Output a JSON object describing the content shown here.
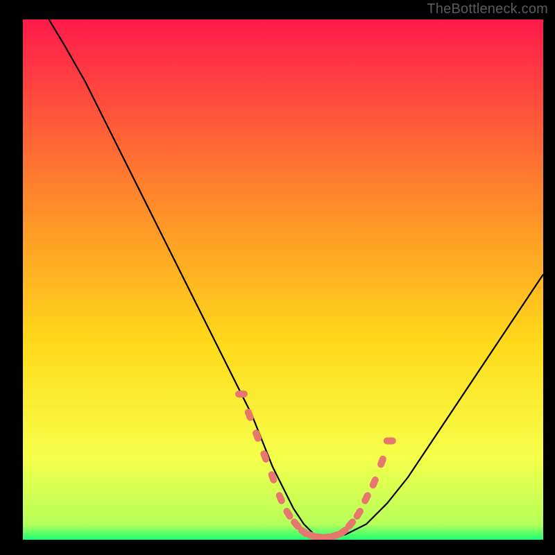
{
  "watermark": "TheBottleneck.com",
  "colors": {
    "frame": "#000000",
    "gradient_top": "#ff1a4b",
    "gradient_mid1": "#ff6a2a",
    "gradient_mid2": "#ffd91a",
    "gradient_mid3": "#f6ff4a",
    "gradient_bottom": "#1eff73",
    "curve": "#000000",
    "dots": "#e7766e"
  },
  "chart_data": {
    "type": "line",
    "title": "",
    "xlabel": "",
    "ylabel": "",
    "xlim": [
      0,
      100
    ],
    "ylim": [
      0,
      100
    ],
    "series": [
      {
        "name": "bottleneck-curve",
        "x": [
          5,
          8,
          12,
          16,
          20,
          24,
          28,
          32,
          36,
          40,
          44,
          48,
          50,
          52,
          54,
          56,
          58,
          60,
          62,
          66,
          70,
          74,
          78,
          82,
          86,
          90,
          94,
          98,
          100
        ],
        "values": [
          100,
          95,
          88,
          80,
          72,
          64,
          56,
          48,
          40,
          32,
          24,
          14,
          10,
          6,
          3,
          1,
          0.5,
          0.5,
          1,
          3,
          7,
          12,
          18,
          24,
          30,
          36,
          42,
          48,
          51
        ]
      }
    ],
    "highlight_points": {
      "name": "dots",
      "x": [
        42,
        43.5,
        45,
        46.5,
        48,
        49.5,
        51,
        52.5,
        54,
        55.5,
        57,
        58.5,
        60,
        61.5,
        63,
        64.5,
        66,
        67.5,
        69,
        70.5
      ],
      "values": [
        28,
        24,
        20,
        16,
        12,
        8,
        5,
        3,
        1.5,
        0.8,
        0.5,
        0.5,
        0.8,
        1.5,
        3,
        5,
        8,
        11,
        15,
        19
      ]
    }
  }
}
